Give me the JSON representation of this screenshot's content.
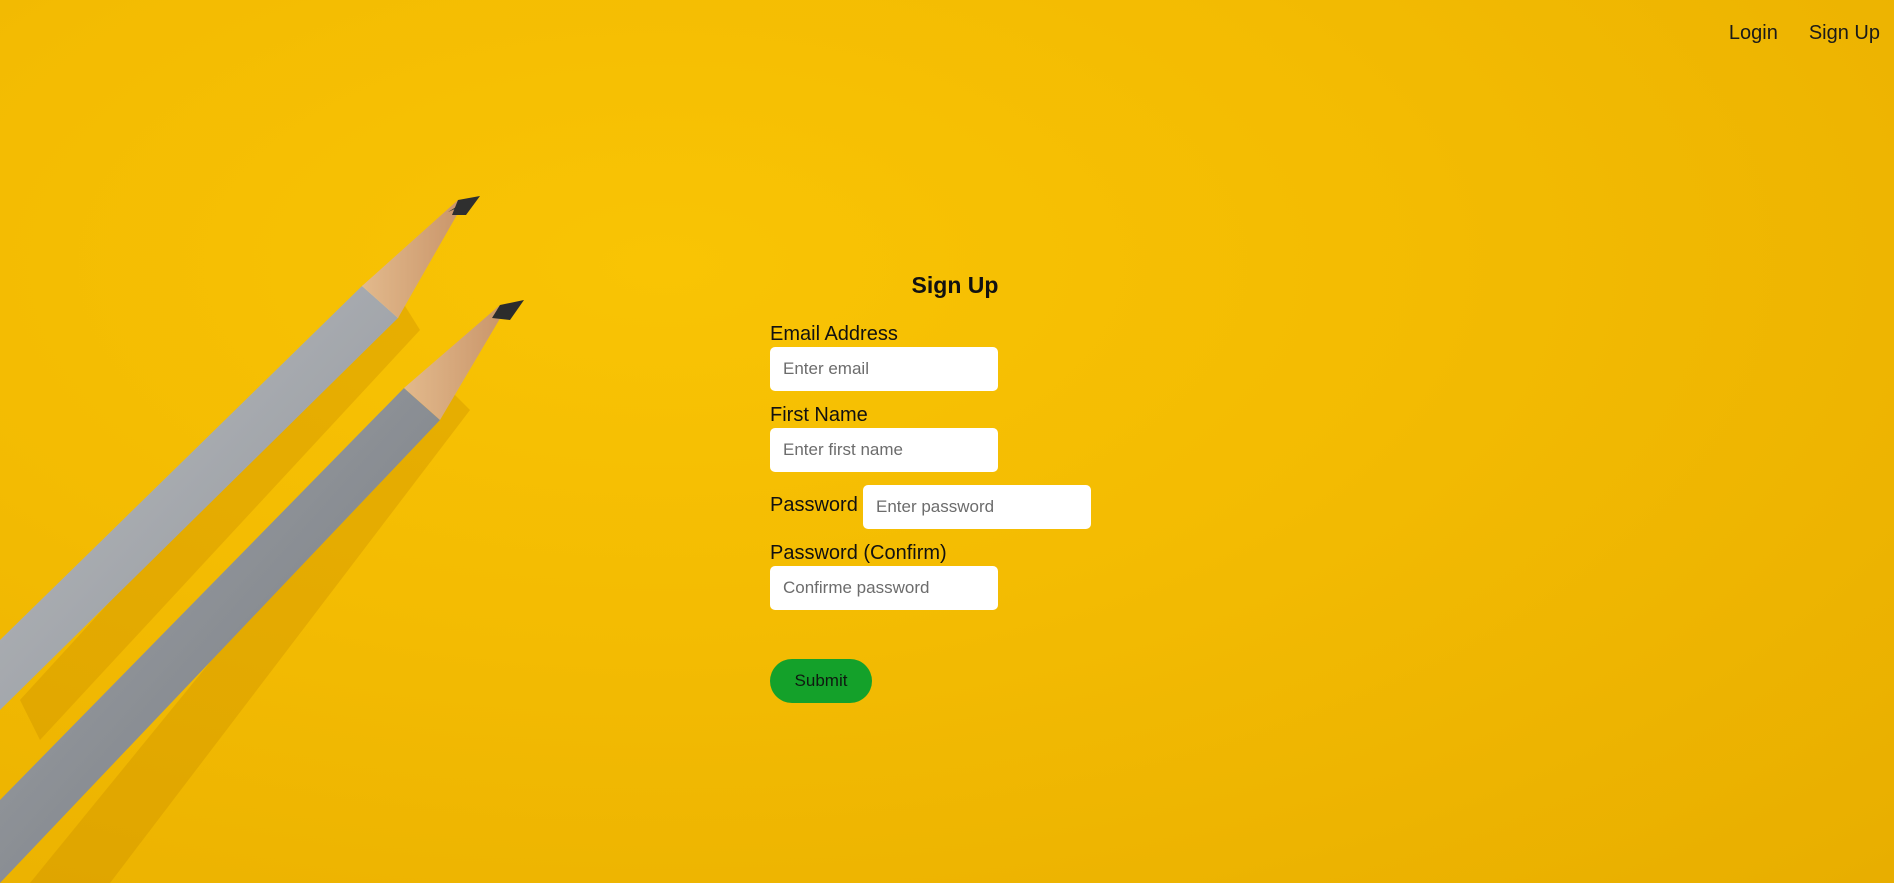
{
  "nav": {
    "login_label": "Login",
    "signup_label": "Sign Up"
  },
  "form": {
    "title": "Sign Up",
    "email": {
      "label": "Email Address",
      "placeholder": "Enter email",
      "value": ""
    },
    "first_name": {
      "label": "First Name",
      "placeholder": "Enter first name",
      "value": ""
    },
    "password": {
      "label": "Password",
      "placeholder": "Enter password",
      "value": ""
    },
    "password_confirm": {
      "label": "Password (Confirm)",
      "placeholder": "Confirme password",
      "value": ""
    },
    "submit_label": "Submit"
  },
  "colors": {
    "background": "#f3bb02",
    "submit_button": "#14a12a",
    "input_background": "#ffffff"
  }
}
